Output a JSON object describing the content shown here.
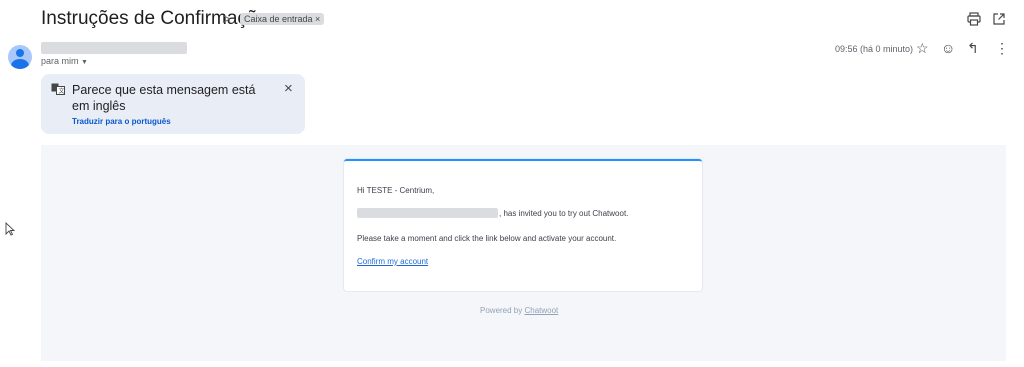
{
  "header": {
    "subject": "Instruções de Confirmação",
    "importance_icon": "importance-marker-icon",
    "label": "Caixa de entrada ×",
    "print_icon": "print-icon",
    "popout_icon": "open-in-new-window-icon"
  },
  "sender": {
    "to_line": "para mim",
    "time": "09:56 (há 0 minuto)",
    "icons": [
      "star-icon",
      "emoji-icon",
      "reply-icon",
      "more-options-icon"
    ]
  },
  "translate_banner": {
    "message": "Parece que esta mensagem está em inglês",
    "link": "Traduzir para o português",
    "close": "×"
  },
  "email_body": {
    "greeting": "Hi TESTE - Centrium,",
    "invite_text": ", has invited you to try out Chatwoot.",
    "instruction": "Please take a moment and click the link below and activate your account.",
    "confirm_link": "Confirm my account",
    "footer_prefix": "Powered by",
    "footer_link": "Chatwoot"
  },
  "colors": {
    "accent_bar": "#1f93ff",
    "link": "#0b57d0",
    "banner_bg": "#e9eef6",
    "email_bg": "#f5f6fa"
  }
}
